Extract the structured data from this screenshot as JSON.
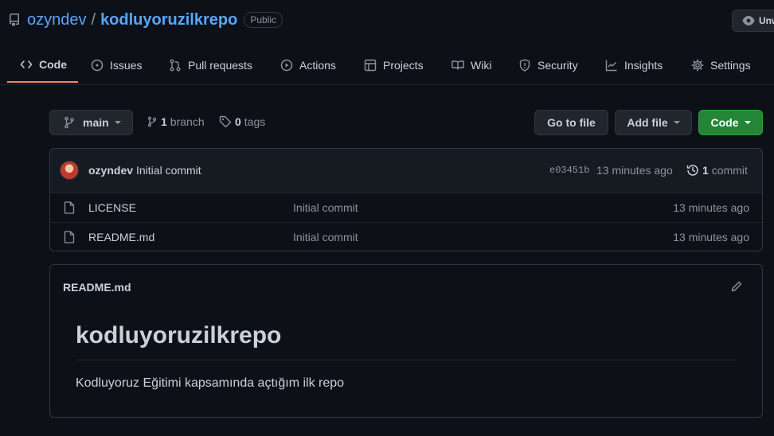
{
  "repo": {
    "owner": "ozyndev",
    "separator": "/",
    "name": "kodluyoruzilkrepo",
    "visibility": "Public",
    "watch_label": "Unw"
  },
  "tabs": [
    {
      "label": "Code",
      "icon": "code-icon",
      "active": true
    },
    {
      "label": "Issues",
      "icon": "issue-icon"
    },
    {
      "label": "Pull requests",
      "icon": "pull-request-icon"
    },
    {
      "label": "Actions",
      "icon": "play-icon"
    },
    {
      "label": "Projects",
      "icon": "project-table-icon"
    },
    {
      "label": "Wiki",
      "icon": "book-icon"
    },
    {
      "label": "Security",
      "icon": "shield-icon"
    },
    {
      "label": "Insights",
      "icon": "graph-icon"
    },
    {
      "label": "Settings",
      "icon": "gear-icon"
    }
  ],
  "toolbar": {
    "branch_name": "main",
    "branch_count": "1",
    "branch_label": "branch",
    "tag_count": "0",
    "tag_label": "tags",
    "go_to_file": "Go to file",
    "add_file": "Add file",
    "code": "Code"
  },
  "commit": {
    "author": "ozyndev",
    "message": "Initial commit",
    "sha": "e03451b",
    "time": "13 minutes ago",
    "count": "1",
    "count_label": "commit"
  },
  "files": [
    {
      "name": "LICENSE",
      "message": "Initial commit",
      "time": "13 minutes ago"
    },
    {
      "name": "README.md",
      "message": "Initial commit",
      "time": "13 minutes ago"
    }
  ],
  "readme": {
    "filename": "README.md",
    "heading": "kodluyoruzilkrepo",
    "body": "Kodluyoruz Eğitimi kapsamında açtığım ilk repo"
  },
  "colors": {
    "background": "#0d1117",
    "link": "#58a6ff",
    "active_tab_underline": "#f78166",
    "primary_button": "#238636"
  }
}
